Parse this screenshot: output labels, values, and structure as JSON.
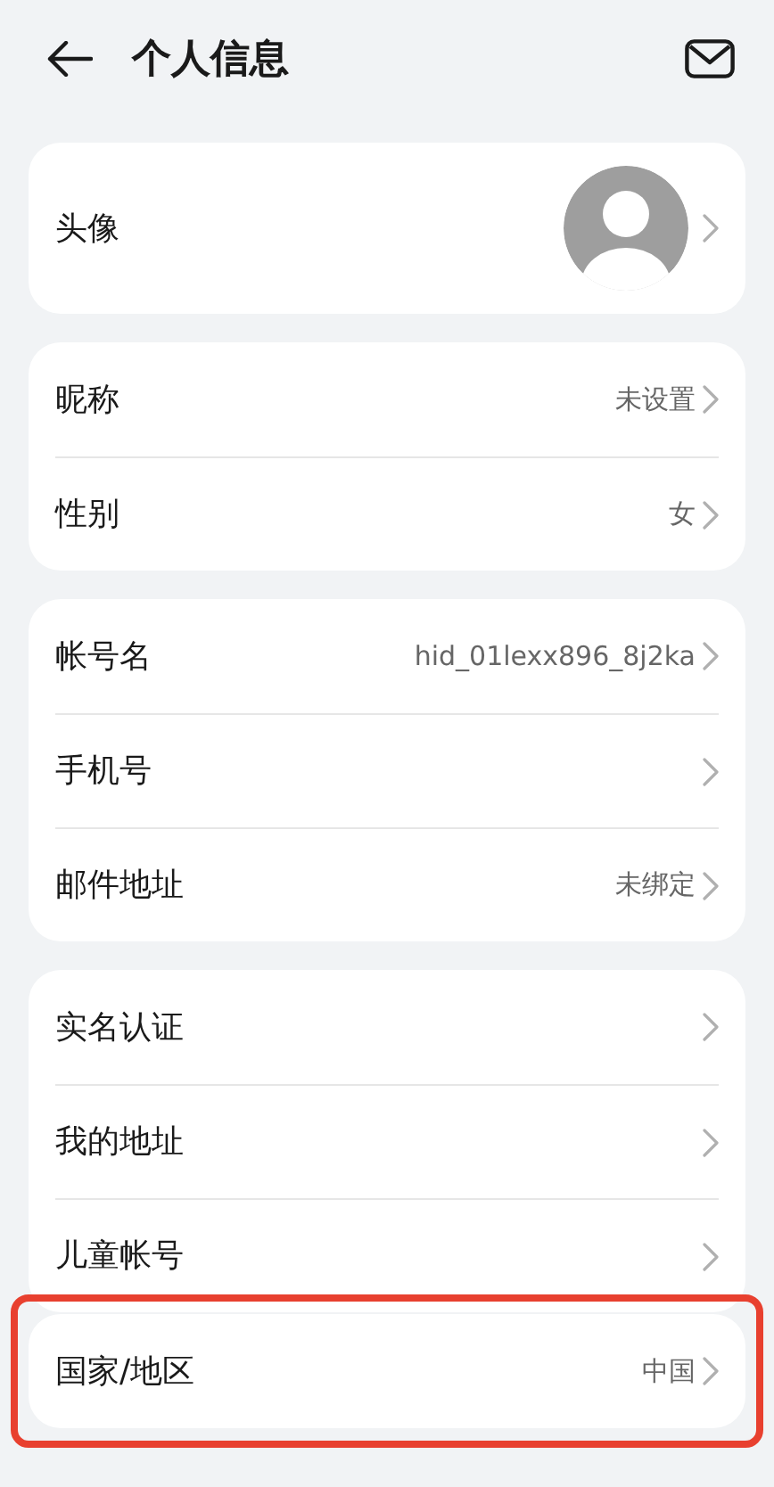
{
  "header": {
    "title": "个人信息"
  },
  "groups": [
    {
      "highlighted": false,
      "items": [
        {
          "kind": "avatar",
          "label": "头像"
        }
      ]
    },
    {
      "highlighted": false,
      "items": [
        {
          "kind": "text",
          "label": "昵称",
          "value": "未设置"
        },
        {
          "kind": "text",
          "label": "性别",
          "value": "女"
        }
      ]
    },
    {
      "highlighted": false,
      "items": [
        {
          "kind": "text",
          "label": "帐号名",
          "value": "hid_01lexx896_8j2ka"
        },
        {
          "kind": "text",
          "label": "手机号"
        },
        {
          "kind": "text",
          "label": "邮件地址",
          "value": "未绑定"
        }
      ]
    },
    {
      "highlighted": false,
      "items": [
        {
          "kind": "text",
          "label": "实名认证"
        },
        {
          "kind": "text",
          "label": "我的地址"
        },
        {
          "kind": "text",
          "label": "儿童帐号"
        }
      ]
    },
    {
      "highlighted": true,
      "items": [
        {
          "kind": "text",
          "label": "国家/地区",
          "value": "中国"
        }
      ]
    }
  ]
}
